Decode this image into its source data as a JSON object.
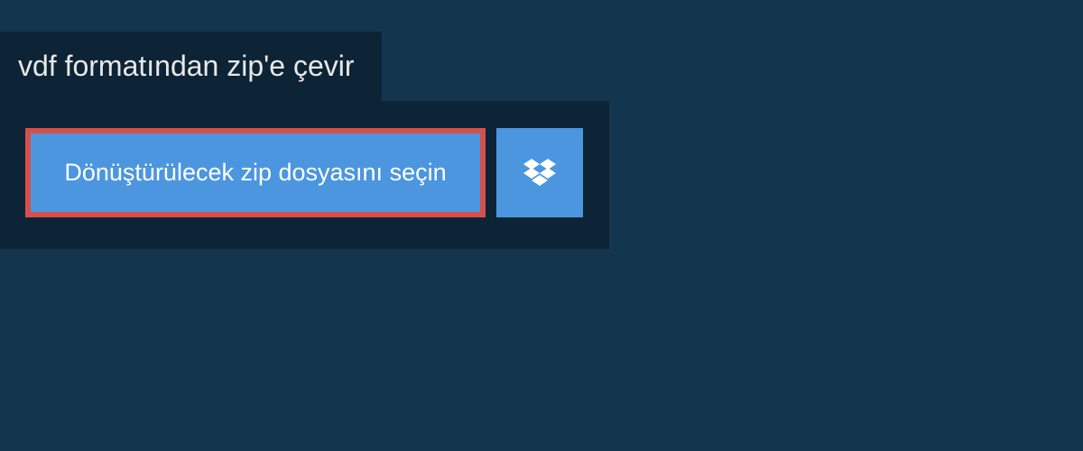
{
  "title": "vdf formatından zip'e çevir",
  "selectFileLabel": "Dönüştürülecek zip dosyasını seçin",
  "colors": {
    "pageBackground": "#14354e",
    "panelBackground": "#0d2436",
    "buttonBackground": "#4b96df",
    "buttonBorder": "#d6504a"
  }
}
